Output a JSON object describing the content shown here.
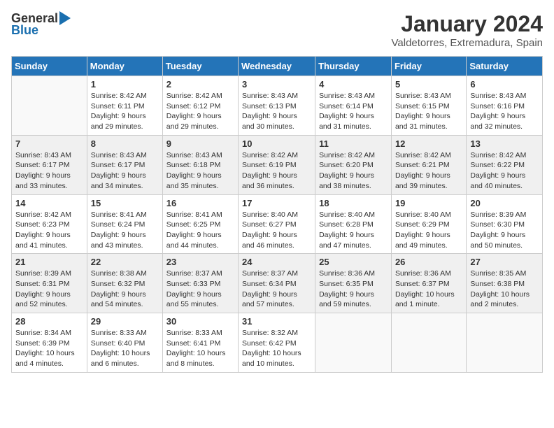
{
  "header": {
    "logo_general": "General",
    "logo_blue": "Blue",
    "title": "January 2024",
    "subtitle": "Valdetorres, Extremadura, Spain"
  },
  "columns": [
    "Sunday",
    "Monday",
    "Tuesday",
    "Wednesday",
    "Thursday",
    "Friday",
    "Saturday"
  ],
  "weeks": [
    [
      {
        "day": "",
        "info": ""
      },
      {
        "day": "1",
        "info": "Sunrise: 8:42 AM\nSunset: 6:11 PM\nDaylight: 9 hours\nand 29 minutes."
      },
      {
        "day": "2",
        "info": "Sunrise: 8:42 AM\nSunset: 6:12 PM\nDaylight: 9 hours\nand 29 minutes."
      },
      {
        "day": "3",
        "info": "Sunrise: 8:43 AM\nSunset: 6:13 PM\nDaylight: 9 hours\nand 30 minutes."
      },
      {
        "day": "4",
        "info": "Sunrise: 8:43 AM\nSunset: 6:14 PM\nDaylight: 9 hours\nand 31 minutes."
      },
      {
        "day": "5",
        "info": "Sunrise: 8:43 AM\nSunset: 6:15 PM\nDaylight: 9 hours\nand 31 minutes."
      },
      {
        "day": "6",
        "info": "Sunrise: 8:43 AM\nSunset: 6:16 PM\nDaylight: 9 hours\nand 32 minutes."
      }
    ],
    [
      {
        "day": "7",
        "info": "Sunrise: 8:43 AM\nSunset: 6:17 PM\nDaylight: 9 hours\nand 33 minutes."
      },
      {
        "day": "8",
        "info": "Sunrise: 8:43 AM\nSunset: 6:17 PM\nDaylight: 9 hours\nand 34 minutes."
      },
      {
        "day": "9",
        "info": "Sunrise: 8:43 AM\nSunset: 6:18 PM\nDaylight: 9 hours\nand 35 minutes."
      },
      {
        "day": "10",
        "info": "Sunrise: 8:42 AM\nSunset: 6:19 PM\nDaylight: 9 hours\nand 36 minutes."
      },
      {
        "day": "11",
        "info": "Sunrise: 8:42 AM\nSunset: 6:20 PM\nDaylight: 9 hours\nand 38 minutes."
      },
      {
        "day": "12",
        "info": "Sunrise: 8:42 AM\nSunset: 6:21 PM\nDaylight: 9 hours\nand 39 minutes."
      },
      {
        "day": "13",
        "info": "Sunrise: 8:42 AM\nSunset: 6:22 PM\nDaylight: 9 hours\nand 40 minutes."
      }
    ],
    [
      {
        "day": "14",
        "info": "Sunrise: 8:42 AM\nSunset: 6:23 PM\nDaylight: 9 hours\nand 41 minutes."
      },
      {
        "day": "15",
        "info": "Sunrise: 8:41 AM\nSunset: 6:24 PM\nDaylight: 9 hours\nand 43 minutes."
      },
      {
        "day": "16",
        "info": "Sunrise: 8:41 AM\nSunset: 6:25 PM\nDaylight: 9 hours\nand 44 minutes."
      },
      {
        "day": "17",
        "info": "Sunrise: 8:40 AM\nSunset: 6:27 PM\nDaylight: 9 hours\nand 46 minutes."
      },
      {
        "day": "18",
        "info": "Sunrise: 8:40 AM\nSunset: 6:28 PM\nDaylight: 9 hours\nand 47 minutes."
      },
      {
        "day": "19",
        "info": "Sunrise: 8:40 AM\nSunset: 6:29 PM\nDaylight: 9 hours\nand 49 minutes."
      },
      {
        "day": "20",
        "info": "Sunrise: 8:39 AM\nSunset: 6:30 PM\nDaylight: 9 hours\nand 50 minutes."
      }
    ],
    [
      {
        "day": "21",
        "info": "Sunrise: 8:39 AM\nSunset: 6:31 PM\nDaylight: 9 hours\nand 52 minutes."
      },
      {
        "day": "22",
        "info": "Sunrise: 8:38 AM\nSunset: 6:32 PM\nDaylight: 9 hours\nand 54 minutes."
      },
      {
        "day": "23",
        "info": "Sunrise: 8:37 AM\nSunset: 6:33 PM\nDaylight: 9 hours\nand 55 minutes."
      },
      {
        "day": "24",
        "info": "Sunrise: 8:37 AM\nSunset: 6:34 PM\nDaylight: 9 hours\nand 57 minutes."
      },
      {
        "day": "25",
        "info": "Sunrise: 8:36 AM\nSunset: 6:35 PM\nDaylight: 9 hours\nand 59 minutes."
      },
      {
        "day": "26",
        "info": "Sunrise: 8:36 AM\nSunset: 6:37 PM\nDaylight: 10 hours\nand 1 minute."
      },
      {
        "day": "27",
        "info": "Sunrise: 8:35 AM\nSunset: 6:38 PM\nDaylight: 10 hours\nand 2 minutes."
      }
    ],
    [
      {
        "day": "28",
        "info": "Sunrise: 8:34 AM\nSunset: 6:39 PM\nDaylight: 10 hours\nand 4 minutes."
      },
      {
        "day": "29",
        "info": "Sunrise: 8:33 AM\nSunset: 6:40 PM\nDaylight: 10 hours\nand 6 minutes."
      },
      {
        "day": "30",
        "info": "Sunrise: 8:33 AM\nSunset: 6:41 PM\nDaylight: 10 hours\nand 8 minutes."
      },
      {
        "day": "31",
        "info": "Sunrise: 8:32 AM\nSunset: 6:42 PM\nDaylight: 10 hours\nand 10 minutes."
      },
      {
        "day": "",
        "info": ""
      },
      {
        "day": "",
        "info": ""
      },
      {
        "day": "",
        "info": ""
      }
    ]
  ]
}
